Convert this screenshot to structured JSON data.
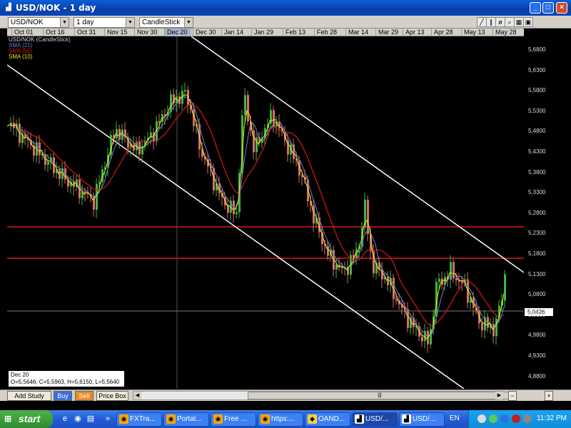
{
  "window": {
    "title": "USD/NOK - 1 day",
    "minimize": "_",
    "maximize": "□",
    "close": "×"
  },
  "toolbar": {
    "symbol": "USD/NOK",
    "interval": "1 day",
    "chart_style": "CandleStick"
  },
  "dates": {
    "labels": [
      "Oct 01",
      "Oct 16",
      "Oct 31",
      "Nov 15",
      "Nov 30",
      "Dec 20",
      "Dec 30",
      "Jan 14",
      "Jan 29",
      "Feb 13",
      "Feb 28",
      "Mar 14",
      "Mar 29",
      "Apr 13",
      "Apr 28",
      "May 13",
      "May 28"
    ],
    "highlighted": "Dec 20"
  },
  "legend": {
    "symbol": "USD/NOK (CandleStick)",
    "items": [
      {
        "label": "SMA (21)",
        "color": "#6f7fd8"
      },
      {
        "label": "SMA (50)",
        "color": "#d81818"
      },
      {
        "label": "SMA (10)",
        "color": "#e8e818"
      }
    ]
  },
  "price_axis": {
    "labels": [
      "5,6800",
      "5,6300",
      "5,5800",
      "5,5300",
      "5,4800",
      "5,4300",
      "5,3800",
      "5,3300",
      "5,2800",
      "5,2300",
      "5,1800",
      "5,1300",
      "5,0800",
      "5,0300",
      "4,9800",
      "4,9300",
      "4,8800"
    ],
    "current": "5,0426"
  },
  "infobox": {
    "date": "Dec 20",
    "ohlc": "O=5,5646, C=5,5963, H=5,6150, L=5,5640"
  },
  "bottom": {
    "add_study": "Add Study",
    "buy": "Buy",
    "sell": "Sell",
    "price_box": "Price Box"
  },
  "taskbar": {
    "start": "start",
    "tasks": [
      {
        "label": "FXTra...",
        "icon": "firefox-icon"
      },
      {
        "label": "Portal...",
        "icon": "firefox-icon"
      },
      {
        "label": "Free ...",
        "icon": "firefox-icon"
      },
      {
        "label": "https:...",
        "icon": "firefox-icon"
      },
      {
        "label": "OAND...",
        "icon": "app-icon"
      },
      {
        "label": "USD/...",
        "icon": "chart-icon"
      },
      {
        "label": "USD/...",
        "icon": "chart-icon"
      }
    ],
    "language": "EN",
    "clock": "11:32 PM"
  },
  "colors": {
    "sma21": "#6f7fd8",
    "sma50": "#d81818",
    "sma10": "#e8e818",
    "candle_up": "#3fb83f",
    "candle_down": "#d86f6f",
    "trendline": "#ffffff",
    "resistance": "#d81818"
  }
}
